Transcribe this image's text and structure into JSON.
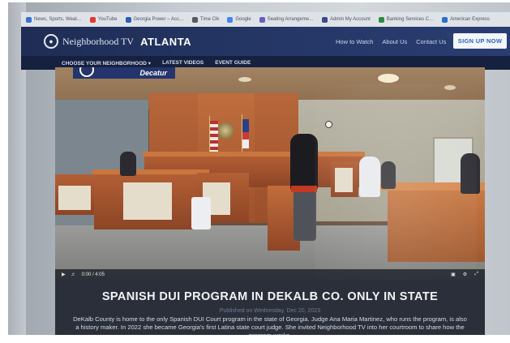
{
  "bookmarks": [
    {
      "label": "News, Sports, Weat…",
      "color": "#3a6fd1"
    },
    {
      "label": "YouTube",
      "color": "#e03a2f"
    },
    {
      "label": "Georgia Power – Acc…",
      "color": "#2b5fb5"
    },
    {
      "label": "Time Clk",
      "color": "#555b66"
    },
    {
      "label": "Google",
      "color": "#4285f4"
    },
    {
      "label": "Seating Arrangeme…",
      "color": "#6a5fbf"
    },
    {
      "label": "Admin My Account",
      "color": "#3c4a8a"
    },
    {
      "label": "Banking Services C…",
      "color": "#2f8a3f"
    },
    {
      "label": "American Express",
      "color": "#2a6fc8"
    }
  ],
  "header": {
    "brand": "Neighborhood TV",
    "city": "ATLANTA",
    "nav": [
      "How to Watch",
      "About Us",
      "Contact Us"
    ],
    "signup_label": "SIGN UP NOW"
  },
  "sub_nav": {
    "neighborhood": "CHOOSE YOUR NEIGHBORHOOD",
    "videos": "LATEST VIDEOS",
    "events": "EVENT GUIDE"
  },
  "video": {
    "location_tag": "Decatur",
    "time_display": "0:00 / 4:05"
  },
  "article": {
    "title": "SPANISH DUI PROGRAM IN DEKALB CO. ONLY IN STATE",
    "date": "Published on Wednesday, Dec 20, 2023",
    "body": "DeKalb County is home to the only Spanish DUI Court program in the state of Georgia. Judge Ana Maria Martinez, who runs the program, is also a history maker. In 2022 she became Georgia's first Latina state court judge. She invited Neighborhood TV into her courtroom to share how the program works."
  }
}
